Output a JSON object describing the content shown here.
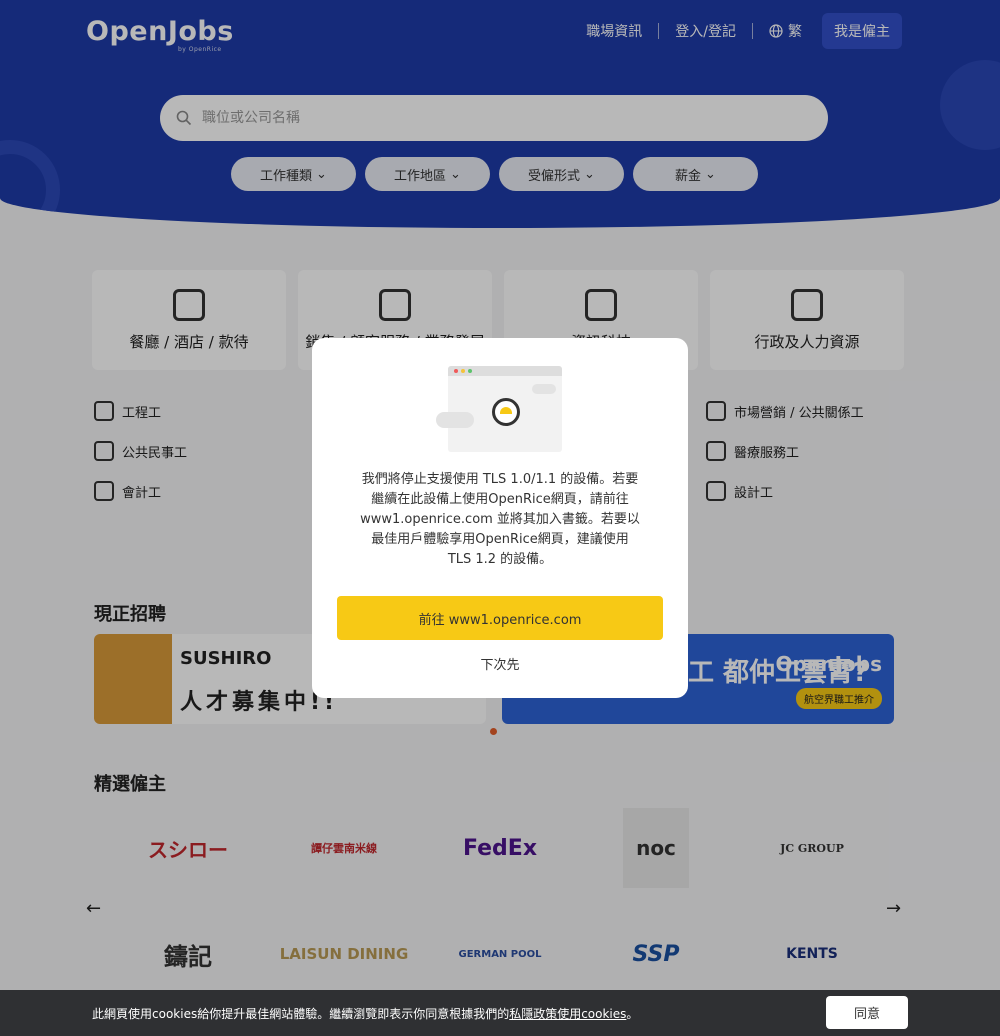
{
  "header": {
    "logo": "OpenJobs",
    "logo_sub": "by OpenRice",
    "nav": {
      "career_info": "職場資訊",
      "login": "登入/登記",
      "language": "繁",
      "employer": "我是僱主"
    }
  },
  "search": {
    "placeholder": "職位或公司名稱"
  },
  "filters": [
    "工作種類",
    "工作地區",
    "受僱形式",
    "薪金"
  ],
  "categories": [
    "餐廳 / 酒店 / 款待",
    "銷售 / 顧客服務 / 業務發展",
    "資訊科技",
    "行政及人力資源"
  ],
  "subcategories": {
    "col1": [
      "工程工",
      "公共民事工",
      "會計工"
    ],
    "col4": [
      "市場營銷 / 公共關係工",
      "醫療服務工",
      "設計工"
    ]
  },
  "sections": {
    "hiring_now": "現正招聘",
    "featured_employers": "精選僱主"
  },
  "banners": {
    "sushiro_brand": "SUSHIRO",
    "sushiro_tagline": "人才募集中!!",
    "openjobs_text": "人工 都仲工雲霄?",
    "openjobs_logo": "OpenJobs",
    "openjobs_pill": "航空界職工推介"
  },
  "employers": [
    "スシロー",
    "譚仔雲南米線",
    "FedEx",
    "noc",
    "JC GROUP",
    "鑄記",
    "LAISUN DINING",
    "GERMAN POOL",
    "SSP",
    "KENTS"
  ],
  "modal": {
    "message": "我們將停止支援使用 TLS 1.0/1.1 的設備。若要繼續在此設備上使用OpenRice網頁，請前往 www1.openrice.com 並將其加入書籤。若要以最佳用戶體驗享用OpenRice網頁，建議使用 TLS 1.2 的設備。",
    "cta": "前往 www1.openrice.com",
    "later": "下次先"
  },
  "cookie": {
    "text": "此網頁使用cookies給你提升最佳網站體驗。繼續瀏覽即表示你同意根據我們的",
    "link": "私隱政策使用cookies",
    "end": "。",
    "agree": "同意"
  },
  "colors": {
    "hero": "#1e3ba8",
    "accent": "#f7c915",
    "cookie_bar": "#2f3033"
  }
}
